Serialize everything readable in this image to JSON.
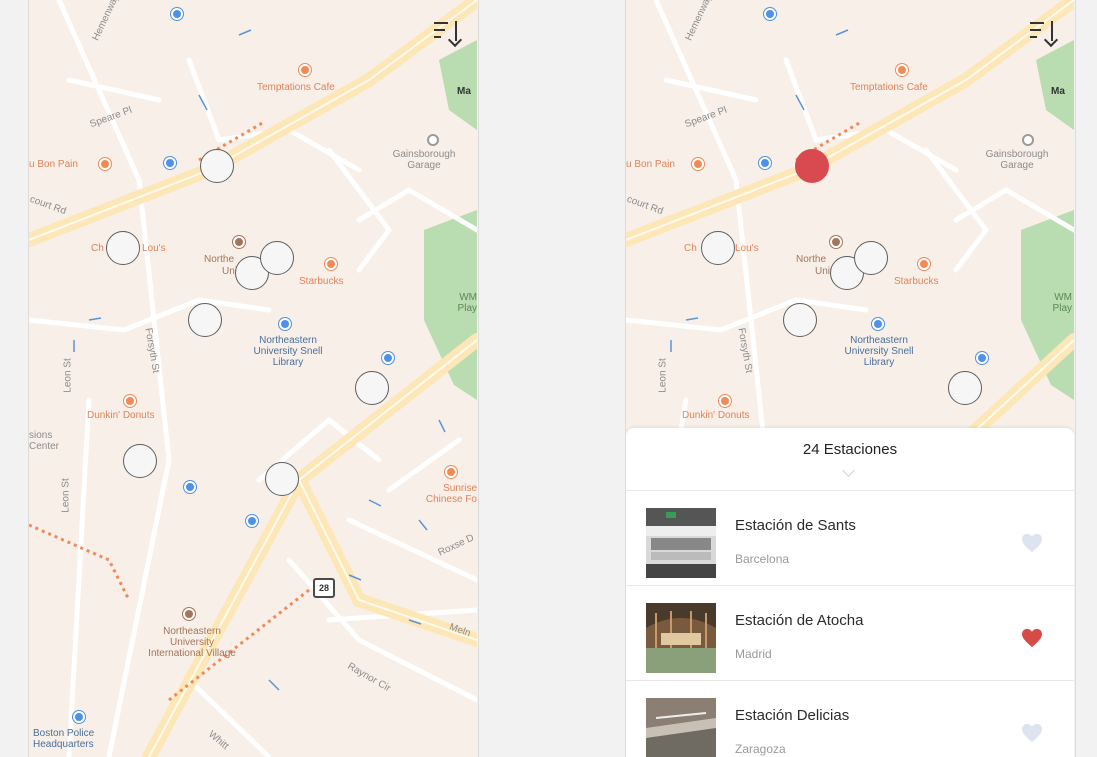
{
  "map": {
    "labels": {
      "temptations": "Temptations Cafe",
      "au_bon_pain": "u Bon Pain",
      "gainsborough": "Gainsborough Garage",
      "chicken_lous": "Ch",
      "chicken_lous_2": "Lou's",
      "northeastern_univ": "Northe",
      "northeastern_univ_2": "Univ",
      "starbucks": "Starbucks",
      "snell": "Northeastern University Snell Library",
      "dunkin": "Dunkin' Donuts",
      "sunrise": "Sunrise Chinese Fo",
      "int_village": "Northeastern University International Village",
      "police": "Boston Police Headquarters",
      "wm": "WM Play",
      "ma": "Ma",
      "missions": "sions Center",
      "route_28": "28",
      "streets": {
        "speare": "Speare Pl",
        "forsyth": "Forsyth St",
        "leon": "Leon St",
        "ruggles": "court Rd",
        "raynor": "Raynor Cir",
        "roxse": "Roxse D",
        "melnea": "Meln",
        "whittier": "Whitt",
        "hemenway": "Hemenway"
      }
    }
  },
  "sheet": {
    "title": "24 Estaciones",
    "stations": [
      {
        "name": "Estación de Sants",
        "city": "Barcelona",
        "favorite": false
      },
      {
        "name": "Estación de Atocha",
        "city": "Madrid",
        "favorite": true
      },
      {
        "name": "Estación Delicias",
        "city": "Zaragoza",
        "favorite": false
      }
    ]
  },
  "colors": {
    "map_bg": "#f7efe8",
    "road": "#fff9ef",
    "major_road": "#fde7b6",
    "marker_selected": "#d94a50",
    "heart_active": "#d64b45",
    "heart_inactive": "#dde3ef",
    "park": "#b9dcb0"
  }
}
